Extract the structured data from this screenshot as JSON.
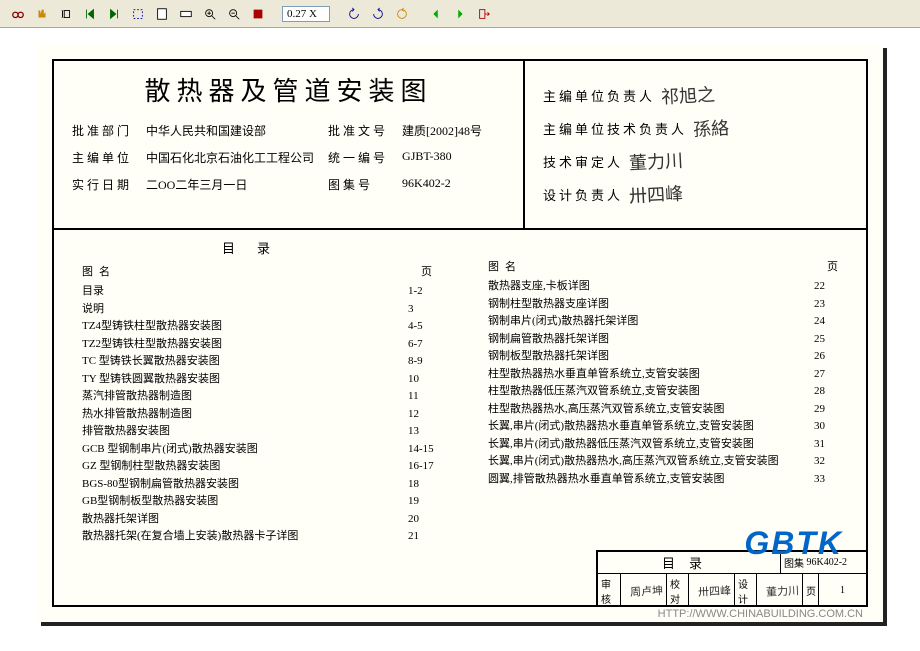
{
  "toolbar": {
    "zoom": "0.27 X"
  },
  "title": "散热器及管道安装图",
  "meta": {
    "approve_dept_lbl": "批准部门",
    "approve_dept": "中华人民共和国建设部",
    "approve_doc_lbl": "批准文号",
    "approve_doc": "建质[2002]48号",
    "main_unit_lbl": "主编单位",
    "main_unit": "中国石化北京石油化工工程公司",
    "uni_no_lbl": "统一编号",
    "uni_no": "GJBT-380",
    "exec_date_lbl": "实行日期",
    "exec_date": "二OO二年三月一日",
    "atlas_no_lbl": "图集号",
    "atlas_no": "96K402-2"
  },
  "sigs": {
    "r1_lbl": "主编单位负责人",
    "r1_sig": "祁旭之",
    "r2_lbl": "主编单位技术负责人",
    "r2_sig": "孫絡",
    "r3_lbl": "技术审定人",
    "r3_sig": "董力川",
    "r4_lbl": "设计负责人",
    "r4_sig": "卅四峰"
  },
  "toc_header": "目录",
  "toc_sub_name": "图名",
  "toc_sub_page": "页",
  "left": [
    {
      "n": "目录",
      "p": "1-2"
    },
    {
      "n": "说明",
      "p": "3"
    },
    {
      "n": "TZ4型铸铁柱型散热器安装图",
      "p": "4-5"
    },
    {
      "n": "TZ2型铸铁柱型散热器安装图",
      "p": "6-7"
    },
    {
      "n": "TC 型铸铁长翼散热器安装图",
      "p": "8-9"
    },
    {
      "n": "TY 型铸铁圆翼散热器安装图",
      "p": "10"
    },
    {
      "n": "蒸汽排管散热器制造图",
      "p": "11"
    },
    {
      "n": "热水排管散热器制造图",
      "p": "12"
    },
    {
      "n": "排管散热器安装图",
      "p": "13"
    },
    {
      "n": "GCB 型钢制串片(闭式)散热器安装图",
      "p": "14-15"
    },
    {
      "n": "GZ 型钢制柱型散热器安装图",
      "p": "16-17"
    },
    {
      "n": "BGS-80型钢制扁管散热器安装图",
      "p": "18"
    },
    {
      "n": "GB型钢制板型散热器安装图",
      "p": "19"
    },
    {
      "n": "散热器托架详图",
      "p": "20"
    },
    {
      "n": "散热器托架(在复合墙上安装)散热器卡子详图",
      "p": "21"
    }
  ],
  "right": [
    {
      "n": "散热器支座,卡板详图",
      "p": "22"
    },
    {
      "n": "钢制柱型散热器支座详图",
      "p": "23"
    },
    {
      "n": "钢制串片(闭式)散热器托架详图",
      "p": "24"
    },
    {
      "n": "钢制扁管散热器托架详图",
      "p": "25"
    },
    {
      "n": "钢制板型散热器托架详图",
      "p": "26"
    },
    {
      "n": "柱型散热器热水垂直单管系统立,支管安装图",
      "p": "27"
    },
    {
      "n": "柱型散热器低压蒸汽双管系统立,支管安装图",
      "p": "28"
    },
    {
      "n": "柱型散热器热水,高压蒸汽双管系统立,支管安装图",
      "p": "29"
    },
    {
      "n": "长翼,串片(闭式)散热器热水垂直单管系统立,支管安装图",
      "p": "30"
    },
    {
      "n": "长翼,串片(闭式)散热器低压蒸汽双管系统立,支管安装图",
      "p": "31"
    },
    {
      "n": "长翼,串片(闭式)散热器热水,高压蒸汽双管系统立,支管安装图",
      "p": "32"
    },
    {
      "n": "圆翼,排管散热器热水垂直单管系统立,支管安装图",
      "p": "33"
    }
  ],
  "footer": {
    "toc_lbl": "目录",
    "atlas_lbl": "图集",
    "atlas_val": "96K402-2",
    "review_lbl": "审核",
    "review_val": "周卢坤",
    "proof_lbl": "校对",
    "proof_val": "卅四峰",
    "design_lbl": "设计",
    "design_val": "董力川",
    "page_lbl": "页",
    "page_val": "1"
  },
  "watermark": "GBTK",
  "url": "HTTP://WWW.CHINABUILDING.COM.CN"
}
